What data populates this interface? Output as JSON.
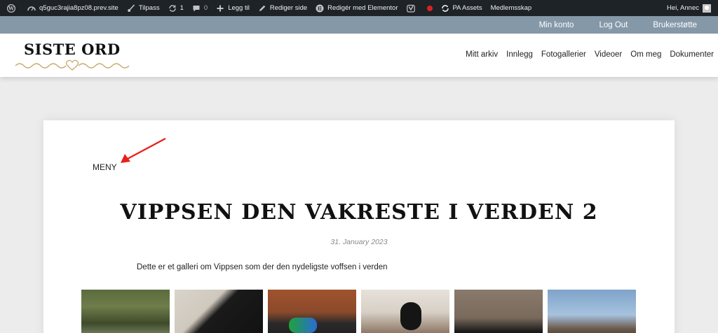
{
  "adminbar": {
    "site": "q5guc3rajia8pz08.prev.site",
    "customize": "Tilpass",
    "updates_count": "1",
    "comments_count": "0",
    "add_new": "Legg til",
    "edit_page": "Rediger side",
    "edit_elementor": "Redigér med Elementor",
    "pa_assets": "PA Assets",
    "membership": "Medlemsskap",
    "greeting": "Hei, Annec"
  },
  "topbar": {
    "links": [
      "Min konto",
      "Log Out",
      "Brukerstøtte"
    ]
  },
  "logo": {
    "text": "SISTE ORD"
  },
  "nav": {
    "items": [
      "Mitt arkiv",
      "Innlegg",
      "Fotogallerier",
      "Videoer",
      "Om meg",
      "Dokumenter"
    ]
  },
  "content": {
    "menu_label": "MENY",
    "title": "VIPPSEN DEN VAKRESTE I VERDEN 2",
    "date": "31. January 2023",
    "excerpt": "Dette er et galleri om Vippsen som der den nydeligste voffsen i verden"
  },
  "colors": {
    "adminbar_bg": "#1d2327",
    "topbar_bg": "#8598a8",
    "logo_accent": "#c9a66b",
    "arrow": "#e8201a"
  }
}
